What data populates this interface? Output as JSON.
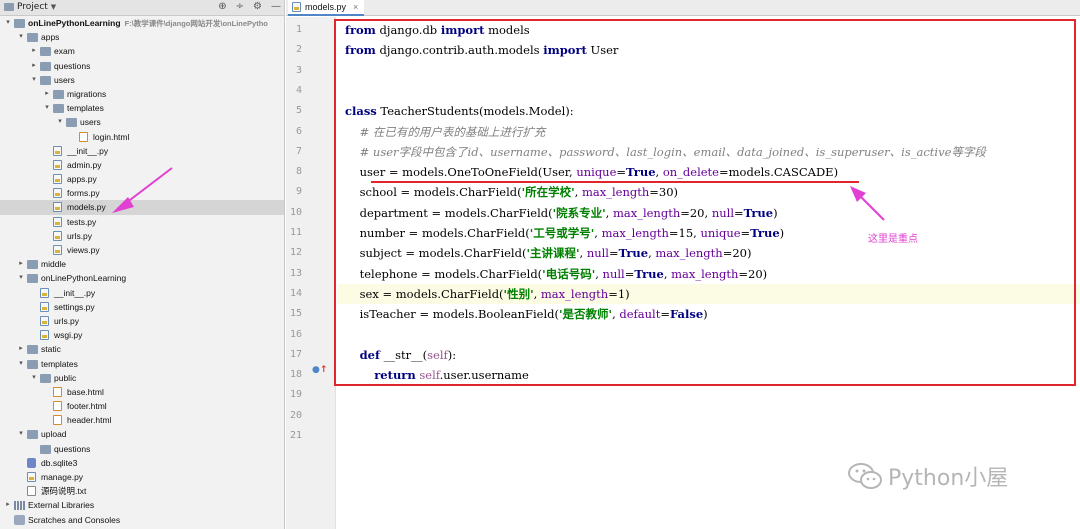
{
  "project_panel": {
    "title": "Project",
    "tree": [
      {
        "label": "onLinePythonLearning",
        "path": "F:\\教学课件\\django网站开发\\onLinePytho",
        "depth": 0,
        "expanded": true,
        "icon": "folder-icon",
        "bold": true
      },
      {
        "label": "apps",
        "depth": 1,
        "expanded": true,
        "icon": "folder-icon"
      },
      {
        "label": "exam",
        "depth": 2,
        "expanded": false,
        "icon": "folder-icon"
      },
      {
        "label": "questions",
        "depth": 2,
        "expanded": false,
        "icon": "folder-icon"
      },
      {
        "label": "users",
        "depth": 2,
        "expanded": true,
        "icon": "folder-icon"
      },
      {
        "label": "migrations",
        "depth": 3,
        "expanded": false,
        "icon": "folder-icon"
      },
      {
        "label": "templates",
        "depth": 3,
        "expanded": true,
        "icon": "folder-icon"
      },
      {
        "label": "users",
        "depth": 4,
        "expanded": true,
        "icon": "folder-icon"
      },
      {
        "label": "login.html",
        "depth": 5,
        "icon": "html-file-icon"
      },
      {
        "label": "__init__.py",
        "depth": 3,
        "icon": "python-file-icon"
      },
      {
        "label": "admin.py",
        "depth": 3,
        "icon": "python-file-icon"
      },
      {
        "label": "apps.py",
        "depth": 3,
        "icon": "python-file-icon"
      },
      {
        "label": "forms.py",
        "depth": 3,
        "icon": "python-file-icon"
      },
      {
        "label": "models.py",
        "depth": 3,
        "icon": "python-file-icon",
        "selected": true
      },
      {
        "label": "tests.py",
        "depth": 3,
        "icon": "python-file-icon"
      },
      {
        "label": "urls.py",
        "depth": 3,
        "icon": "python-file-icon"
      },
      {
        "label": "views.py",
        "depth": 3,
        "icon": "python-file-icon"
      },
      {
        "label": "middle",
        "depth": 1,
        "expanded": false,
        "icon": "folder-icon"
      },
      {
        "label": "onLinePythonLearning",
        "depth": 1,
        "expanded": true,
        "icon": "folder-icon"
      },
      {
        "label": "__init__.py",
        "depth": 2,
        "icon": "python-file-icon"
      },
      {
        "label": "settings.py",
        "depth": 2,
        "icon": "python-file-icon"
      },
      {
        "label": "urls.py",
        "depth": 2,
        "icon": "python-file-icon"
      },
      {
        "label": "wsgi.py",
        "depth": 2,
        "icon": "python-file-icon"
      },
      {
        "label": "static",
        "depth": 1,
        "expanded": false,
        "icon": "folder-icon"
      },
      {
        "label": "templates",
        "depth": 1,
        "expanded": true,
        "icon": "folder-icon"
      },
      {
        "label": "public",
        "depth": 2,
        "expanded": true,
        "icon": "folder-icon"
      },
      {
        "label": "base.html",
        "depth": 3,
        "icon": "html-file-icon"
      },
      {
        "label": "footer.html",
        "depth": 3,
        "icon": "html-file-icon"
      },
      {
        "label": "header.html",
        "depth": 3,
        "icon": "html-file-icon"
      },
      {
        "label": "upload",
        "depth": 1,
        "expanded": true,
        "icon": "folder-icon"
      },
      {
        "label": "questions",
        "depth": 2,
        "icon": "folder-icon"
      },
      {
        "label": "db.sqlite3",
        "depth": 1,
        "icon": "database-file-icon"
      },
      {
        "label": "manage.py",
        "depth": 1,
        "icon": "python-file-icon"
      },
      {
        "label": "源码说明.txt",
        "depth": 1,
        "icon": "text-file-icon"
      },
      {
        "label": "External Libraries",
        "depth": 0,
        "expanded": false,
        "icon": "libraries-icon"
      },
      {
        "label": "Scratches and Consoles",
        "depth": 0,
        "icon": "scratches-icon"
      }
    ]
  },
  "editor": {
    "tab_label": "models.py",
    "current_line": 14,
    "line_numbers": [
      "1",
      "2",
      "3",
      "4",
      "5",
      "6",
      "7",
      "8",
      "9",
      "10",
      "11",
      "12",
      "13",
      "14",
      "15",
      "16",
      "17",
      "18",
      "19",
      "20",
      "21"
    ],
    "lines": [
      [
        {
          "t": "from",
          "c": "kw"
        },
        {
          "t": " django.db ",
          "c": ""
        },
        {
          "t": "import",
          "c": "kw"
        },
        {
          "t": " models",
          "c": ""
        }
      ],
      [
        {
          "t": "from",
          "c": "kw"
        },
        {
          "t": " django.contrib.auth.models ",
          "c": ""
        },
        {
          "t": "import",
          "c": "kw"
        },
        {
          "t": " User",
          "c": ""
        }
      ],
      [],
      [],
      [
        {
          "t": "class",
          "c": "kw"
        },
        {
          "t": " TeacherStudents(models.Model):",
          "c": ""
        }
      ],
      [
        {
          "t": "    # 在已有的用户表的基础上进行扩充",
          "c": "cmt"
        }
      ],
      [
        {
          "t": "    # user字段中包含了id、username、password、last_login、email、data_joined、is_superuser、is_active等字段",
          "c": "cmt"
        }
      ],
      [
        {
          "t": "    user = models.OneToOneField(User, ",
          "c": ""
        },
        {
          "t": "unique",
          "c": "kwarg"
        },
        {
          "t": "=",
          "c": ""
        },
        {
          "t": "True",
          "c": "bi"
        },
        {
          "t": ", ",
          "c": ""
        },
        {
          "t": "on_delete",
          "c": "kwarg"
        },
        {
          "t": "=models.CASCADE)",
          "c": ""
        }
      ],
      [
        {
          "t": "    school = models.CharField(",
          "c": ""
        },
        {
          "t": "'所在学校'",
          "c": "str"
        },
        {
          "t": ", ",
          "c": ""
        },
        {
          "t": "max_length",
          "c": "kwarg"
        },
        {
          "t": "=30)",
          "c": ""
        }
      ],
      [
        {
          "t": "    department = models.CharField(",
          "c": ""
        },
        {
          "t": "'院系专业'",
          "c": "str"
        },
        {
          "t": ", ",
          "c": ""
        },
        {
          "t": "max_length",
          "c": "kwarg"
        },
        {
          "t": "=20, ",
          "c": ""
        },
        {
          "t": "null",
          "c": "kwarg"
        },
        {
          "t": "=",
          "c": ""
        },
        {
          "t": "True",
          "c": "bi"
        },
        {
          "t": ")",
          "c": ""
        }
      ],
      [
        {
          "t": "    number = models.CharField(",
          "c": ""
        },
        {
          "t": "'工号或学号'",
          "c": "str"
        },
        {
          "t": ", ",
          "c": ""
        },
        {
          "t": "max_length",
          "c": "kwarg"
        },
        {
          "t": "=15, ",
          "c": ""
        },
        {
          "t": "unique",
          "c": "kwarg"
        },
        {
          "t": "=",
          "c": ""
        },
        {
          "t": "True",
          "c": "bi"
        },
        {
          "t": ")",
          "c": ""
        }
      ],
      [
        {
          "t": "    subject = models.CharField(",
          "c": ""
        },
        {
          "t": "'主讲课程'",
          "c": "str"
        },
        {
          "t": ", ",
          "c": ""
        },
        {
          "t": "null",
          "c": "kwarg"
        },
        {
          "t": "=",
          "c": ""
        },
        {
          "t": "True",
          "c": "bi"
        },
        {
          "t": ", ",
          "c": ""
        },
        {
          "t": "max_length",
          "c": "kwarg"
        },
        {
          "t": "=20)",
          "c": ""
        }
      ],
      [
        {
          "t": "    telephone = models.CharField(",
          "c": ""
        },
        {
          "t": "'电话号码'",
          "c": "str"
        },
        {
          "t": ", ",
          "c": ""
        },
        {
          "t": "null",
          "c": "kwarg"
        },
        {
          "t": "=",
          "c": ""
        },
        {
          "t": "True",
          "c": "bi"
        },
        {
          "t": ", ",
          "c": ""
        },
        {
          "t": "max_length",
          "c": "kwarg"
        },
        {
          "t": "=20)",
          "c": ""
        }
      ],
      [
        {
          "t": "    sex = models.CharField(",
          "c": ""
        },
        {
          "t": "'性别'",
          "c": "str"
        },
        {
          "t": ", ",
          "c": ""
        },
        {
          "t": "max_length",
          "c": "kwarg"
        },
        {
          "t": "=1)",
          "c": ""
        }
      ],
      [
        {
          "t": "    isTeacher = models.BooleanField(",
          "c": ""
        },
        {
          "t": "'是否教师'",
          "c": "str"
        },
        {
          "t": ", ",
          "c": ""
        },
        {
          "t": "default",
          "c": "kwarg"
        },
        {
          "t": "=",
          "c": ""
        },
        {
          "t": "False",
          "c": "bi"
        },
        {
          "t": ")",
          "c": ""
        }
      ],
      [],
      [
        {
          "t": "    ",
          "c": ""
        },
        {
          "t": "def",
          "c": "kw"
        },
        {
          "t": " __str__(",
          "c": ""
        },
        {
          "t": "self",
          "c": "selfkw"
        },
        {
          "t": "):",
          "c": ""
        }
      ],
      [
        {
          "t": "        ",
          "c": ""
        },
        {
          "t": "return",
          "c": "kw"
        },
        {
          "t": " ",
          "c": ""
        },
        {
          "t": "self",
          "c": "selfkw"
        },
        {
          "t": ".user.username",
          "c": ""
        }
      ],
      [],
      [],
      []
    ]
  },
  "annotation": {
    "text": "这里是重点",
    "color": "#e23fd3"
  },
  "highlight_color": "#e0262b",
  "watermark": {
    "text": "Python小屋"
  }
}
